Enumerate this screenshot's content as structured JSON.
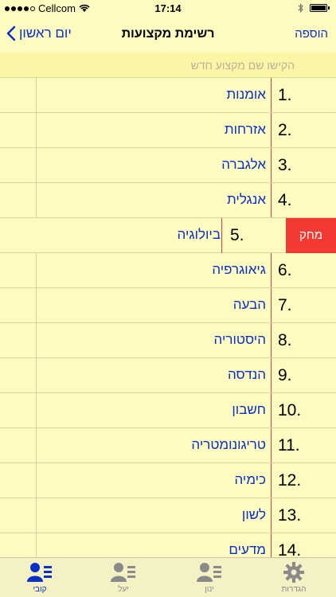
{
  "status": {
    "carrier": "Cellcom",
    "time": "17:14"
  },
  "nav": {
    "back_label": "יום ראשון",
    "title": "רשימת מקצועות",
    "add_label": "הוספה"
  },
  "search": {
    "placeholder": "הקישו שם מקצוע חדש"
  },
  "subjects": [
    {
      "num": "1.",
      "name": "אומנות"
    },
    {
      "num": "2.",
      "name": "אזרחות"
    },
    {
      "num": "3.",
      "name": "אלגברה"
    },
    {
      "num": "4.",
      "name": "אנגלית"
    },
    {
      "num": "5.",
      "name": "ביולוגיה"
    },
    {
      "num": "6.",
      "name": "גיאוגרפיה"
    },
    {
      "num": "7.",
      "name": "הבעה"
    },
    {
      "num": "8.",
      "name": "היסטוריה"
    },
    {
      "num": "9.",
      "name": "הנדסה"
    },
    {
      "num": "10.",
      "name": "חשבון"
    },
    {
      "num": "11.",
      "name": "טריגונומטריה"
    },
    {
      "num": "12.",
      "name": "כימיה"
    },
    {
      "num": "13.",
      "name": "לשון"
    },
    {
      "num": "14.",
      "name": "מדעים"
    }
  ],
  "swipe": {
    "delete_label": "מחק"
  },
  "tabs": [
    {
      "label": "קובי",
      "icon": "contact-card-icon",
      "active": true
    },
    {
      "label": "יעל",
      "icon": "contact-card-icon",
      "active": false
    },
    {
      "label": "ינון",
      "icon": "contact-card-icon",
      "active": false
    },
    {
      "label": "הגדרות",
      "icon": "gear-icon",
      "active": false
    }
  ],
  "colors": {
    "background": "#fdfbc0",
    "accent": "#0a30c8",
    "delete": "#f33a32",
    "margin_line": "#e34040"
  }
}
